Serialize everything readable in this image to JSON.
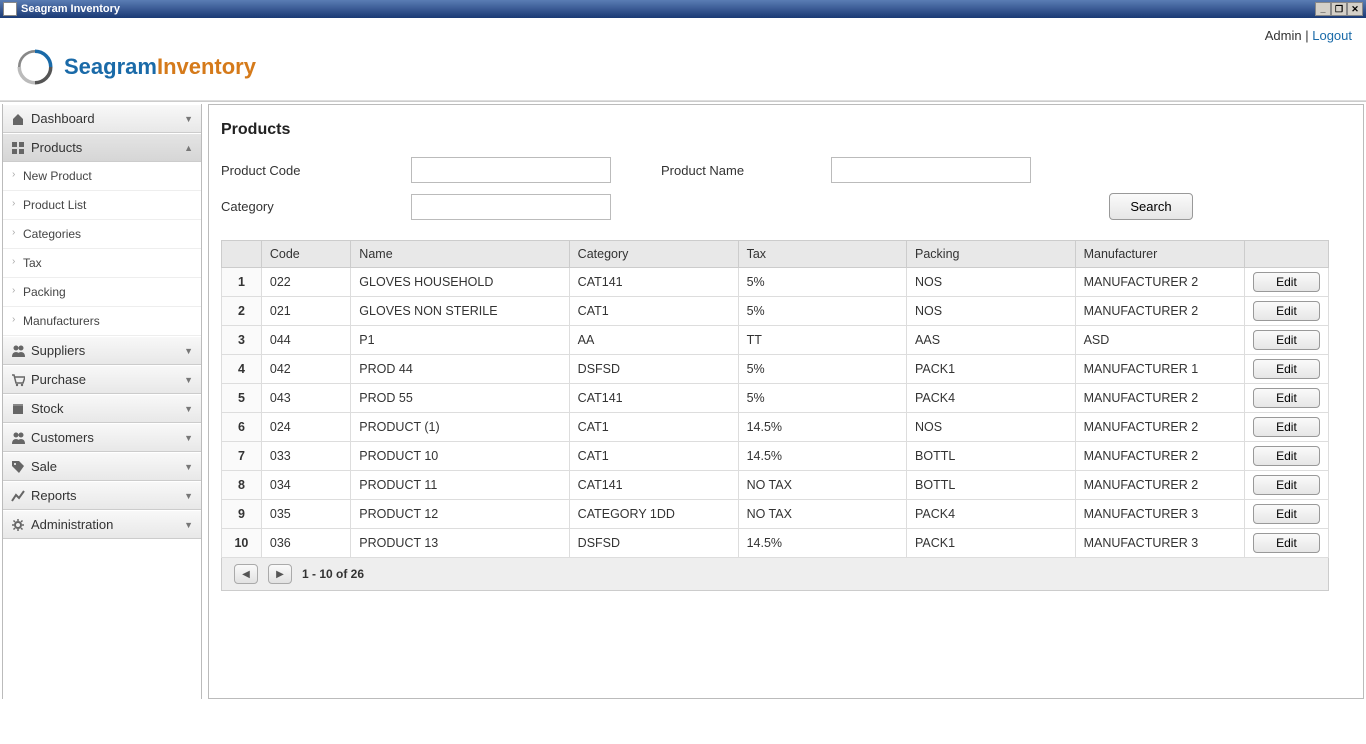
{
  "window": {
    "title": "Seagram Inventory"
  },
  "header": {
    "links": {
      "admin": "Admin",
      "sep": " | ",
      "logout": "Logout"
    },
    "logo": {
      "part1": "Seagram",
      "part2": "Inventory"
    }
  },
  "sidebar": {
    "items": [
      {
        "key": "dashboard",
        "label": "Dashboard",
        "icon": "home",
        "expanded": false
      },
      {
        "key": "products",
        "label": "Products",
        "icon": "grid",
        "expanded": true,
        "children": [
          {
            "label": "New Product"
          },
          {
            "label": "Product List"
          },
          {
            "label": "Categories"
          },
          {
            "label": "Tax"
          },
          {
            "label": "Packing"
          },
          {
            "label": "Manufacturers"
          }
        ]
      },
      {
        "key": "suppliers",
        "label": "Suppliers",
        "icon": "users",
        "expanded": false
      },
      {
        "key": "purchase",
        "label": "Purchase",
        "icon": "cart",
        "expanded": false
      },
      {
        "key": "stock",
        "label": "Stock",
        "icon": "box",
        "expanded": false
      },
      {
        "key": "customers",
        "label": "Customers",
        "icon": "users",
        "expanded": false
      },
      {
        "key": "sale",
        "label": "Sale",
        "icon": "tag",
        "expanded": false
      },
      {
        "key": "reports",
        "label": "Reports",
        "icon": "chart",
        "expanded": false
      },
      {
        "key": "administration",
        "label": "Administration",
        "icon": "gear",
        "expanded": false
      }
    ]
  },
  "page": {
    "title": "Products",
    "search": {
      "product_code_label": "Product Code",
      "product_name_label": "Product Name",
      "category_label": "Category",
      "button": "Search"
    },
    "table": {
      "headers": [
        "",
        "Code",
        "Name",
        "Category",
        "Tax",
        "Packing",
        "Manufacturer",
        ""
      ],
      "edit_label": "Edit",
      "rows": [
        {
          "n": "1",
          "code": "022",
          "name": "GLOVES HOUSEHOLD",
          "category": "CAT141",
          "tax": "5%",
          "packing": "NOS",
          "manufacturer": "MANUFACTURER 2"
        },
        {
          "n": "2",
          "code": "021",
          "name": "GLOVES NON STERILE",
          "category": "CAT1",
          "tax": "5%",
          "packing": "NOS",
          "manufacturer": "MANUFACTURER 2"
        },
        {
          "n": "3",
          "code": "044",
          "name": "P1",
          "category": "AA",
          "tax": "TT",
          "packing": "AAS",
          "manufacturer": "ASD"
        },
        {
          "n": "4",
          "code": "042",
          "name": "PROD 44",
          "category": "DSFSD",
          "tax": "5%",
          "packing": "PACK1",
          "manufacturer": "MANUFACTURER 1"
        },
        {
          "n": "5",
          "code": "043",
          "name": "PROD 55",
          "category": "CAT141",
          "tax": "5%",
          "packing": "PACK4",
          "manufacturer": "MANUFACTURER 2"
        },
        {
          "n": "6",
          "code": "024",
          "name": "PRODUCT (1)",
          "category": "CAT1",
          "tax": "14.5%",
          "packing": "NOS",
          "manufacturer": "MANUFACTURER 2"
        },
        {
          "n": "7",
          "code": "033",
          "name": "PRODUCT 10",
          "category": "CAT1",
          "tax": "14.5%",
          "packing": "BOTTL",
          "manufacturer": "MANUFACTURER 2"
        },
        {
          "n": "8",
          "code": "034",
          "name": "PRODUCT 11",
          "category": "CAT141",
          "tax": "NO TAX",
          "packing": "BOTTL",
          "manufacturer": "MANUFACTURER 2"
        },
        {
          "n": "9",
          "code": "035",
          "name": "PRODUCT 12",
          "category": "CATEGORY 1DD",
          "tax": "NO TAX",
          "packing": "PACK4",
          "manufacturer": "MANUFACTURER 3"
        },
        {
          "n": "10",
          "code": "036",
          "name": "PRODUCT 13",
          "category": "DSFSD",
          "tax": "14.5%",
          "packing": "PACK1",
          "manufacturer": "MANUFACTURER 3"
        }
      ]
    },
    "pagination": {
      "info": "1 - 10 of 26"
    }
  }
}
